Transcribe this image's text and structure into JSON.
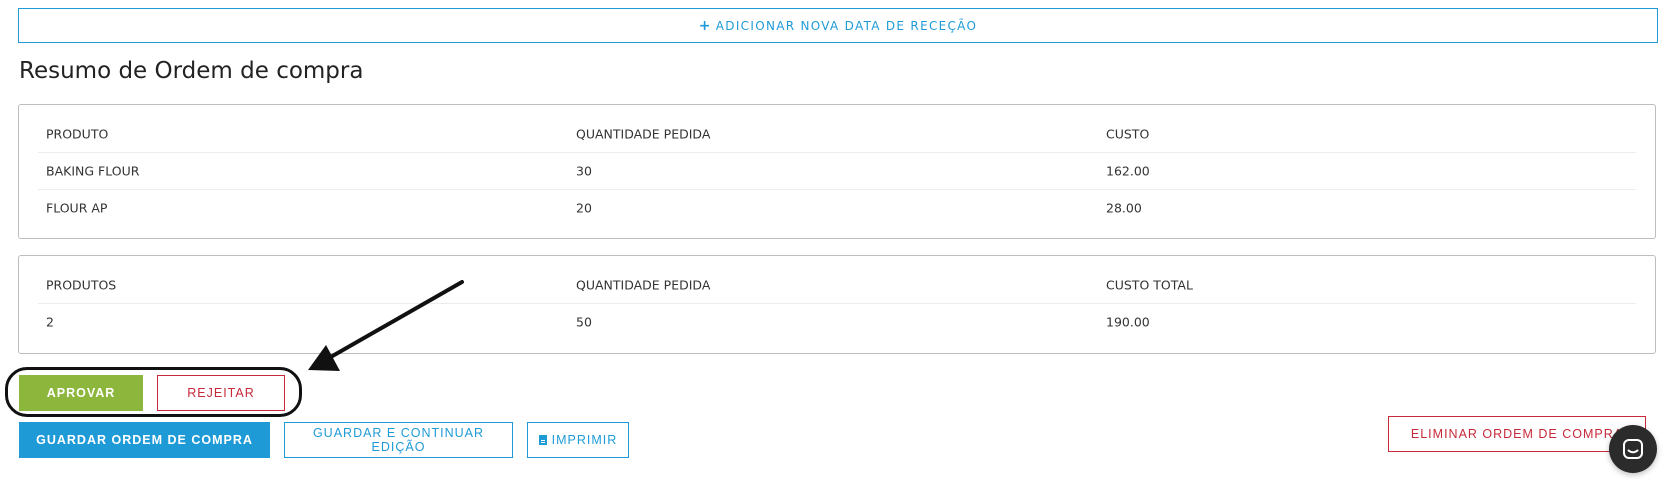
{
  "add_date_button": {
    "icon": "plus-icon",
    "label": "ADICIONAR NOVA DATA DE RECEÇÃO"
  },
  "summary_title": "Resumo de Ordem de compra",
  "items_table": {
    "headers": [
      "PRODUTO",
      "QUANTIDADE PEDIDA",
      "CUSTO"
    ],
    "rows": [
      [
        "BAKING FLOUR",
        "30",
        "162.00"
      ],
      [
        "FLOUR AP",
        "20",
        "28.00"
      ]
    ]
  },
  "totals_table": {
    "headers": [
      "PRODUTOS",
      "QUANTIDADE PEDIDA",
      "CUSTO TOTAL"
    ],
    "rows": [
      [
        "2",
        "50",
        "190.00"
      ]
    ]
  },
  "actions": {
    "approve": "APROVAR",
    "reject": "REJEITAR",
    "save": "GUARDAR ORDEM DE COMPRA",
    "save_continue": "GUARDAR E CONTINUAR EDIÇÃO",
    "print": "IMPRIMIR",
    "delete": "ELIMINAR ORDEM DE COMPRA"
  },
  "colors": {
    "primary": "#1e9bd7",
    "approve": "#8cb63c",
    "danger": "#c62a3a",
    "chat": "#2b2b2b"
  },
  "chat_widget": {
    "icon": "chat-icon"
  }
}
